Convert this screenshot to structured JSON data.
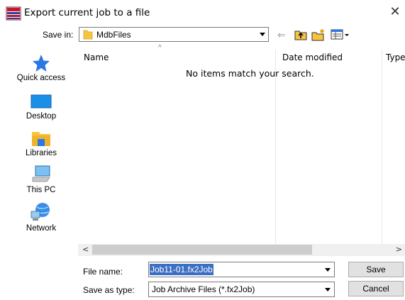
{
  "window": {
    "title": "Export current job to a file",
    "icon": "app-icon",
    "close_glyph": "✕"
  },
  "save_in": {
    "label": "Save in:",
    "value": "MdbFiles"
  },
  "toolbar": {
    "back_glyph": "⇐",
    "icons": [
      "back-icon",
      "up-folder-icon",
      "new-folder-icon",
      "view-menu-icon"
    ]
  },
  "sidebar": {
    "items": [
      {
        "label": "Quick access",
        "icon": "star-icon"
      },
      {
        "label": "Desktop",
        "icon": "desktop-icon"
      },
      {
        "label": "Libraries",
        "icon": "libraries-icon"
      },
      {
        "label": "This PC",
        "icon": "computer-icon"
      },
      {
        "label": "Network",
        "icon": "network-icon"
      }
    ]
  },
  "file_list": {
    "columns": [
      "Name",
      "Date modified",
      "Type"
    ],
    "sort_glyph": "^",
    "empty_message": "No items match your search."
  },
  "hscroll": {
    "left_glyph": "<",
    "right_glyph": ">"
  },
  "bottom": {
    "filename_label": "File name:",
    "filename_value": "Job11-01.fx2Job",
    "savetype_label": "Save as type:",
    "savetype_value": "Job Archive Files (*.fx2Job)",
    "save_label": "Save",
    "cancel_label": "Cancel"
  },
  "colors": {
    "selection": "#3b6fc4",
    "folder_yellow": "#f5c542",
    "accent_blue": "#2b78e4"
  }
}
